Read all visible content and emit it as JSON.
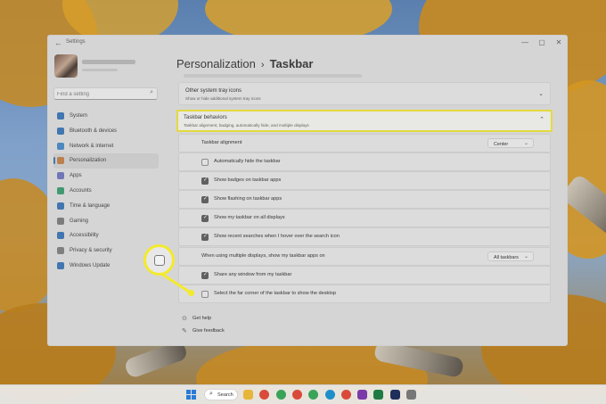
{
  "window": {
    "app_title": "Settings",
    "controls": {
      "minimize": "—",
      "maximize": "▢",
      "close": "✕"
    }
  },
  "sidebar": {
    "search_placeholder": "Find a setting",
    "items": [
      {
        "label": "System",
        "icon": "monitor-icon",
        "color": "#2f6fb6"
      },
      {
        "label": "Bluetooth & devices",
        "icon": "bluetooth-icon",
        "color": "#2f6fb6"
      },
      {
        "label": "Network & internet",
        "icon": "wifi-icon",
        "color": "#3b86c8"
      },
      {
        "label": "Personalization",
        "icon": "brush-icon",
        "color": "#c67a3c"
      },
      {
        "label": "Apps",
        "icon": "apps-icon",
        "color": "#6a6fbf"
      },
      {
        "label": "Accounts",
        "icon": "person-icon",
        "color": "#2f9a6a"
      },
      {
        "label": "Time & language",
        "icon": "globe-clock-icon",
        "color": "#2f6fb6"
      },
      {
        "label": "Gaming",
        "icon": "gamepad-icon",
        "color": "#777777"
      },
      {
        "label": "Accessibility",
        "icon": "accessibility-icon",
        "color": "#2f6fb6"
      },
      {
        "label": "Privacy & security",
        "icon": "shield-icon",
        "color": "#7a7a7a"
      },
      {
        "label": "Windows Update",
        "icon": "update-icon",
        "color": "#2f6fb6"
      }
    ],
    "active_index": 3
  },
  "breadcrumb": {
    "parent": "Personalization",
    "separator": "›",
    "current": "Taskbar"
  },
  "other_tray": {
    "title": "Other system tray icons",
    "subtitle": "Show or hide additional system tray icons"
  },
  "behaviors": {
    "title": "Taskbar behaviors",
    "subtitle": "Taskbar alignment, badging, automatically hide, and multiple displays"
  },
  "settings": {
    "alignment": {
      "label": "Taskbar alignment",
      "value": "Center"
    },
    "auto_hide": {
      "label": "Automatically hide the taskbar",
      "checked": false
    },
    "badges": {
      "label": "Show badges on taskbar apps",
      "checked": true
    },
    "flashing": {
      "label": "Show flashing on taskbar apps",
      "checked": true
    },
    "all_displays": {
      "label": "Show my taskbar on all displays",
      "checked": true
    },
    "recent_searches": {
      "label": "Show recent searches when I hover over the search icon",
      "checked": true
    },
    "multi_display": {
      "label": "When using multiple displays, show my taskbar apps on",
      "value": "All taskbars"
    },
    "share_window": {
      "label": "Share any window from my taskbar",
      "checked": true
    },
    "far_corner": {
      "label": "Select the far corner of the taskbar to show the desktop",
      "checked": false
    }
  },
  "help": {
    "get_help": "Get help",
    "give_feedback": "Give feedback"
  },
  "taskbar": {
    "search_label": "Search",
    "apps": [
      {
        "icon": "file-explorer-icon",
        "color": "#e7b53b"
      },
      {
        "icon": "chrome-icon",
        "color": "#d94a3a"
      },
      {
        "icon": "chrome-icon",
        "color": "#3aa35a"
      },
      {
        "icon": "chrome-icon",
        "color": "#d94a3a"
      },
      {
        "icon": "chrome-icon",
        "color": "#3aa35a"
      },
      {
        "icon": "edge-icon",
        "color": "#1f8fc9"
      },
      {
        "icon": "chrome-icon",
        "color": "#d94a3a"
      },
      {
        "icon": "onenote-icon",
        "color": "#7a3aa8"
      },
      {
        "icon": "excel-icon",
        "color": "#1f7a44"
      },
      {
        "icon": "photoshop-icon",
        "color": "#1f2f5a"
      },
      {
        "icon": "settings-icon",
        "color": "#777777"
      }
    ]
  }
}
